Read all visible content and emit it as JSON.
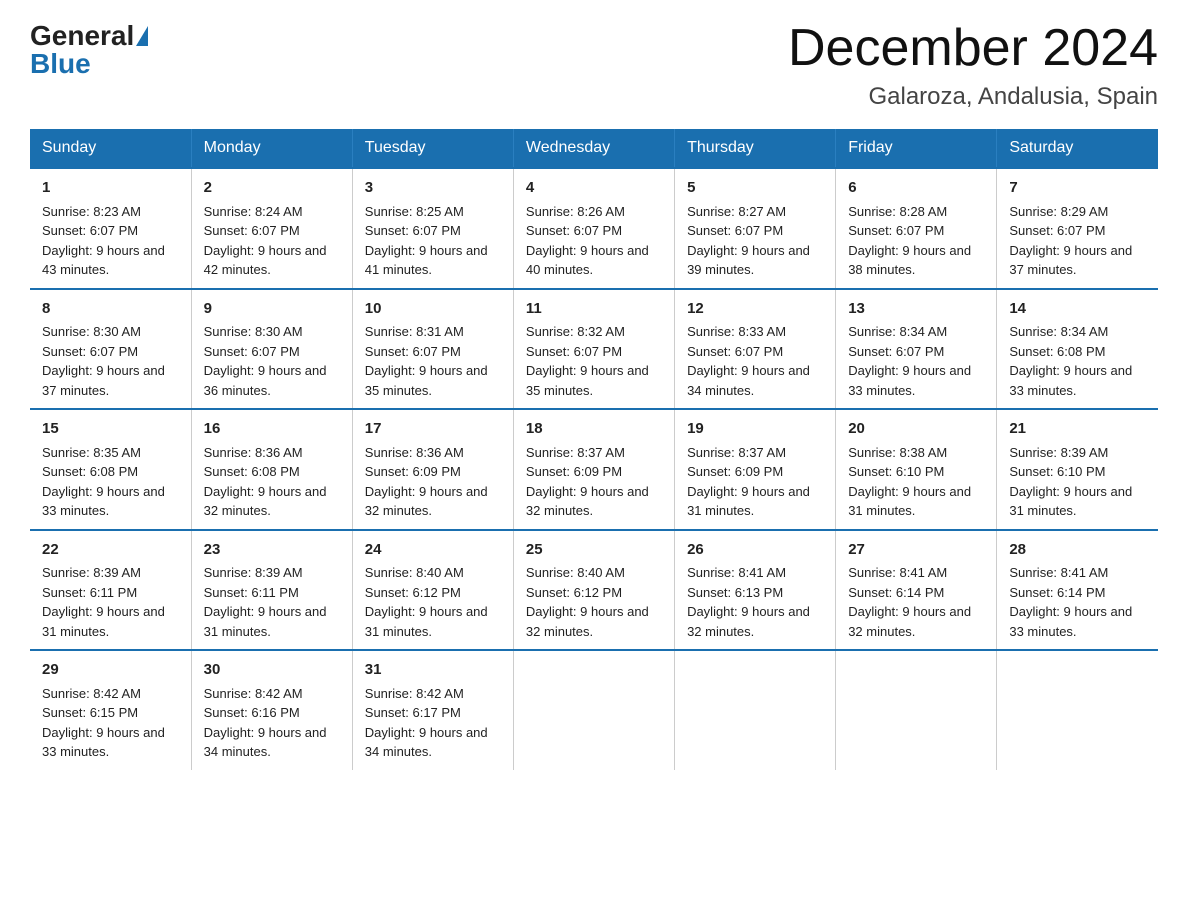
{
  "header": {
    "logo_general": "General",
    "logo_blue": "Blue",
    "month_title": "December 2024",
    "location": "Galaroza, Andalusia, Spain"
  },
  "days_of_week": [
    "Sunday",
    "Monday",
    "Tuesday",
    "Wednesday",
    "Thursday",
    "Friday",
    "Saturday"
  ],
  "weeks": [
    [
      {
        "day": "1",
        "sunrise": "8:23 AM",
        "sunset": "6:07 PM",
        "daylight": "9 hours and 43 minutes."
      },
      {
        "day": "2",
        "sunrise": "8:24 AM",
        "sunset": "6:07 PM",
        "daylight": "9 hours and 42 minutes."
      },
      {
        "day": "3",
        "sunrise": "8:25 AM",
        "sunset": "6:07 PM",
        "daylight": "9 hours and 41 minutes."
      },
      {
        "day": "4",
        "sunrise": "8:26 AM",
        "sunset": "6:07 PM",
        "daylight": "9 hours and 40 minutes."
      },
      {
        "day": "5",
        "sunrise": "8:27 AM",
        "sunset": "6:07 PM",
        "daylight": "9 hours and 39 minutes."
      },
      {
        "day": "6",
        "sunrise": "8:28 AM",
        "sunset": "6:07 PM",
        "daylight": "9 hours and 38 minutes."
      },
      {
        "day": "7",
        "sunrise": "8:29 AM",
        "sunset": "6:07 PM",
        "daylight": "9 hours and 37 minutes."
      }
    ],
    [
      {
        "day": "8",
        "sunrise": "8:30 AM",
        "sunset": "6:07 PM",
        "daylight": "9 hours and 37 minutes."
      },
      {
        "day": "9",
        "sunrise": "8:30 AM",
        "sunset": "6:07 PM",
        "daylight": "9 hours and 36 minutes."
      },
      {
        "day": "10",
        "sunrise": "8:31 AM",
        "sunset": "6:07 PM",
        "daylight": "9 hours and 35 minutes."
      },
      {
        "day": "11",
        "sunrise": "8:32 AM",
        "sunset": "6:07 PM",
        "daylight": "9 hours and 35 minutes."
      },
      {
        "day": "12",
        "sunrise": "8:33 AM",
        "sunset": "6:07 PM",
        "daylight": "9 hours and 34 minutes."
      },
      {
        "day": "13",
        "sunrise": "8:34 AM",
        "sunset": "6:07 PM",
        "daylight": "9 hours and 33 minutes."
      },
      {
        "day": "14",
        "sunrise": "8:34 AM",
        "sunset": "6:08 PM",
        "daylight": "9 hours and 33 minutes."
      }
    ],
    [
      {
        "day": "15",
        "sunrise": "8:35 AM",
        "sunset": "6:08 PM",
        "daylight": "9 hours and 33 minutes."
      },
      {
        "day": "16",
        "sunrise": "8:36 AM",
        "sunset": "6:08 PM",
        "daylight": "9 hours and 32 minutes."
      },
      {
        "day": "17",
        "sunrise": "8:36 AM",
        "sunset": "6:09 PM",
        "daylight": "9 hours and 32 minutes."
      },
      {
        "day": "18",
        "sunrise": "8:37 AM",
        "sunset": "6:09 PM",
        "daylight": "9 hours and 32 minutes."
      },
      {
        "day": "19",
        "sunrise": "8:37 AM",
        "sunset": "6:09 PM",
        "daylight": "9 hours and 31 minutes."
      },
      {
        "day": "20",
        "sunrise": "8:38 AM",
        "sunset": "6:10 PM",
        "daylight": "9 hours and 31 minutes."
      },
      {
        "day": "21",
        "sunrise": "8:39 AM",
        "sunset": "6:10 PM",
        "daylight": "9 hours and 31 minutes."
      }
    ],
    [
      {
        "day": "22",
        "sunrise": "8:39 AM",
        "sunset": "6:11 PM",
        "daylight": "9 hours and 31 minutes."
      },
      {
        "day": "23",
        "sunrise": "8:39 AM",
        "sunset": "6:11 PM",
        "daylight": "9 hours and 31 minutes."
      },
      {
        "day": "24",
        "sunrise": "8:40 AM",
        "sunset": "6:12 PM",
        "daylight": "9 hours and 31 minutes."
      },
      {
        "day": "25",
        "sunrise": "8:40 AM",
        "sunset": "6:12 PM",
        "daylight": "9 hours and 32 minutes."
      },
      {
        "day": "26",
        "sunrise": "8:41 AM",
        "sunset": "6:13 PM",
        "daylight": "9 hours and 32 minutes."
      },
      {
        "day": "27",
        "sunrise": "8:41 AM",
        "sunset": "6:14 PM",
        "daylight": "9 hours and 32 minutes."
      },
      {
        "day": "28",
        "sunrise": "8:41 AM",
        "sunset": "6:14 PM",
        "daylight": "9 hours and 33 minutes."
      }
    ],
    [
      {
        "day": "29",
        "sunrise": "8:42 AM",
        "sunset": "6:15 PM",
        "daylight": "9 hours and 33 minutes."
      },
      {
        "day": "30",
        "sunrise": "8:42 AM",
        "sunset": "6:16 PM",
        "daylight": "9 hours and 34 minutes."
      },
      {
        "day": "31",
        "sunrise": "8:42 AM",
        "sunset": "6:17 PM",
        "daylight": "9 hours and 34 minutes."
      },
      null,
      null,
      null,
      null
    ]
  ],
  "labels": {
    "sunrise": "Sunrise:",
    "sunset": "Sunset:",
    "daylight": "Daylight:"
  }
}
